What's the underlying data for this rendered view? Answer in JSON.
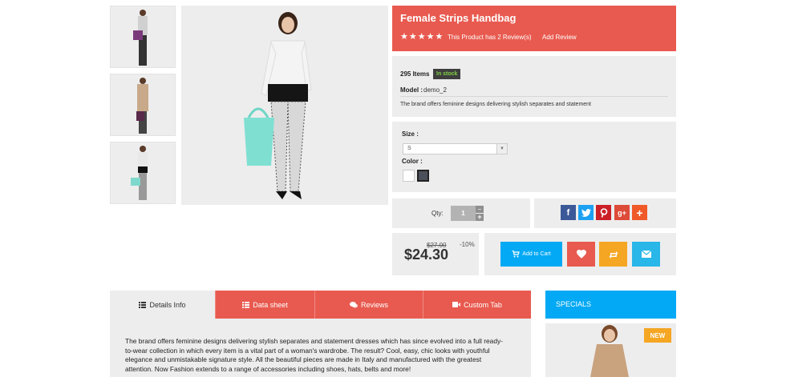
{
  "product": {
    "name": "Female Strips Handbag",
    "reviews_text": "This Product has 2 Review(s)",
    "add_review": "Add Review",
    "stars": "★★★★★",
    "items_count": "295 Items",
    "stock_badge": "In stock",
    "model_label": "Model :",
    "model_value": "demo_2",
    "short_desc": "The brand offers feminine designs delivering stylish separates and statement"
  },
  "options": {
    "size_label": "Size :",
    "size_value": "S",
    "color_label": "Color :"
  },
  "qty": {
    "label": "Qty:",
    "value": "1",
    "plus": "+",
    "minus": "−"
  },
  "price": {
    "old": "$27.00",
    "discount": "-10%",
    "current": "$24.30"
  },
  "actions": {
    "add_to_cart": "Add to Cart"
  },
  "social": {
    "facebook": "f",
    "google": "g+",
    "more": "+"
  },
  "tabs": [
    {
      "label": "Details Info"
    },
    {
      "label": "Data sheet"
    },
    {
      "label": "Reviews"
    },
    {
      "label": "Custom Tab"
    }
  ],
  "description": "The brand offers feminine designs delivering stylish separates and statement dresses which has since evolved into a full ready-to-wear collection in which every item is a vital part of a woman's wardrobe. The result? Cool, easy, chic looks with youthful elegance and unmistakable signature style. All the beautiful pieces are made in Italy and manufactured with the greatest attention. Now Fashion extends to a range of accessories including shoes, hats, belts and more!",
  "specials": {
    "title": "SPECIALS",
    "badge": "NEW"
  },
  "colors": {
    "accent_red": "#e85a4f",
    "accent_blue": "#03a9f4",
    "orange": "#f5a623",
    "panel_gray": "#ededed"
  }
}
